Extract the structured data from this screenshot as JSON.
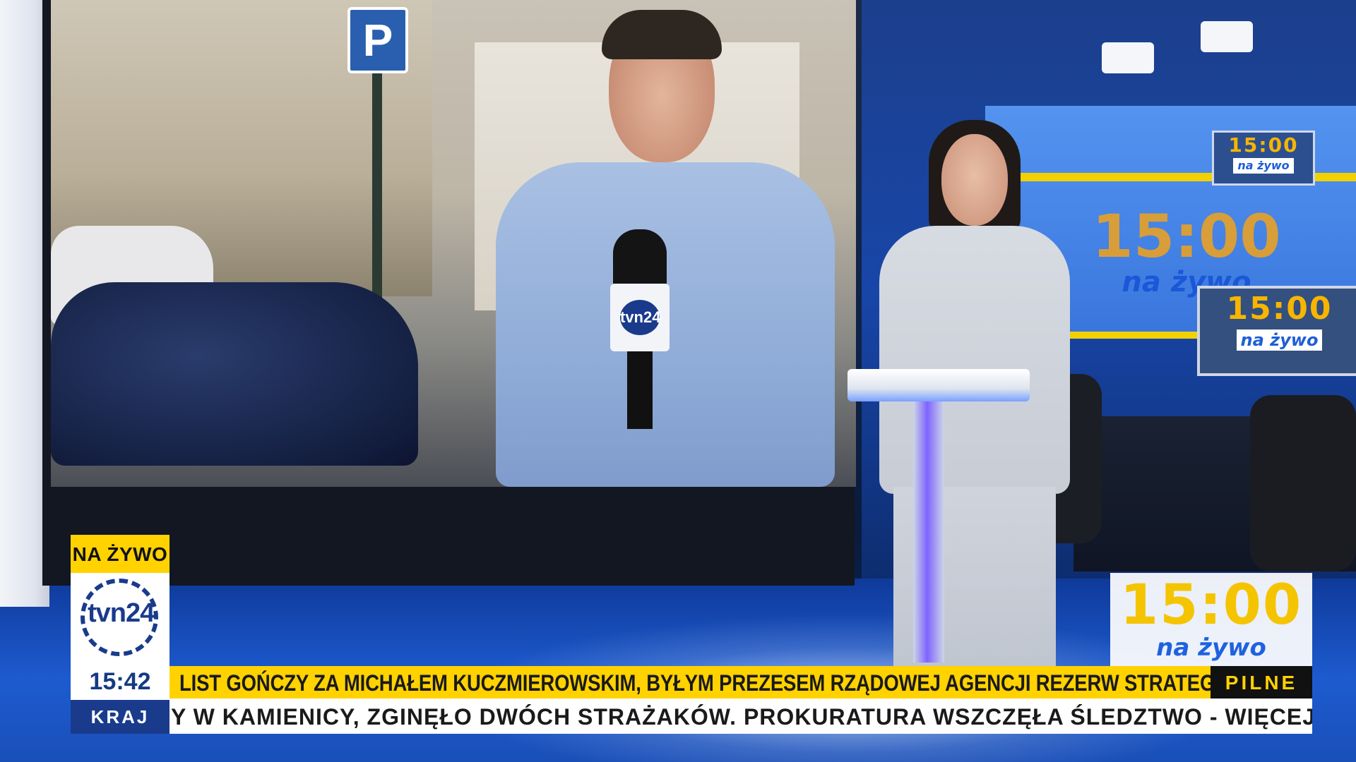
{
  "broadcast": {
    "live_badge": "NA ŻYWO",
    "channel_logo": "tvn24",
    "clock": "15:42",
    "category": "KRAJ",
    "headline": "LIST GOŃCZY ZA MICHAŁEM KUCZMIEROWSKIM, BYŁYM PREZESEM RZĄDOWEJ AGENCJI REZERW STRATEGICZNYCH",
    "urgent_label": "PILNE",
    "ticker": "Y W KAMIENICY, ZGINĘŁO DWÓCH STRAŻAKÓW. PROKURATURA WSZCZĘŁA ŚLEDZTWO - WIĘCEJ W",
    "program_time": "15:00",
    "program_subtitle": "na żywo"
  },
  "studio": {
    "parking_sign": "P",
    "mic_flag_logo": "tvn24",
    "wall_time": "15:00",
    "wall_subtitle": "na żywo",
    "monitor_small_time": "15:00",
    "monitor_small_subtitle": "na żywo",
    "monitor_big_time": "15:00",
    "monitor_big_subtitle": "na żywo"
  },
  "colors": {
    "accent_yellow": "#ffd200",
    "brand_blue": "#1a3b8c",
    "program_yellow": "#f5c400",
    "program_blue": "#1f62e0"
  }
}
